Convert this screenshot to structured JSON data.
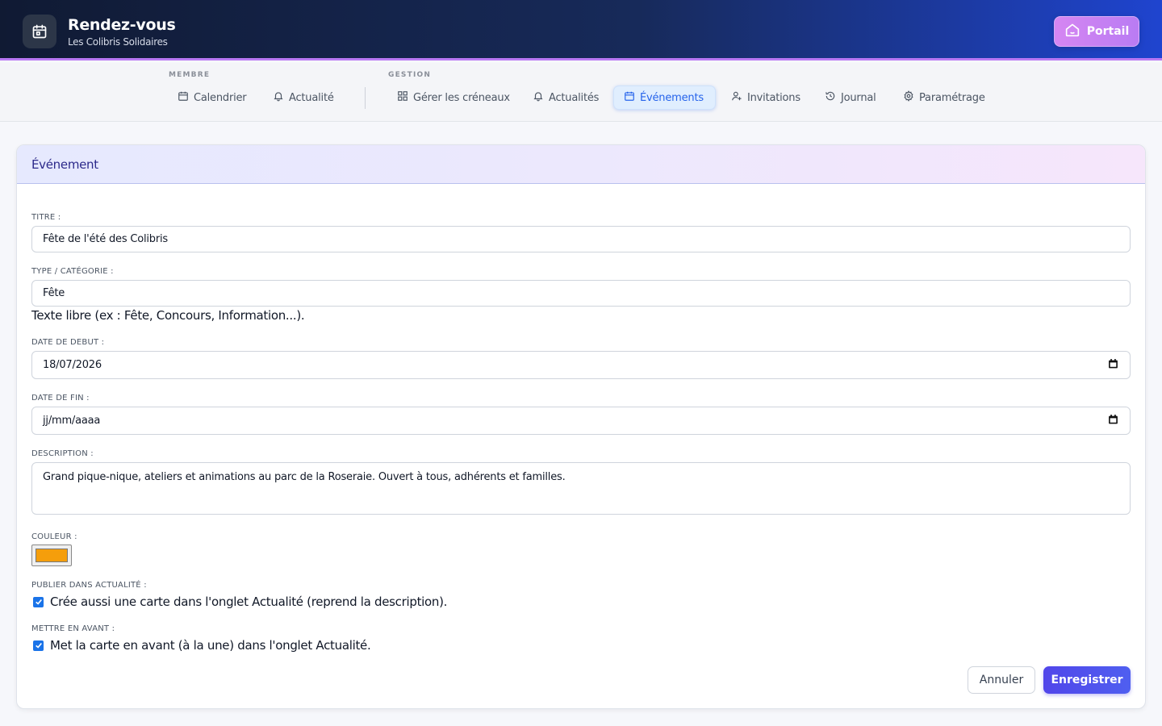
{
  "header": {
    "title": "Rendez-vous",
    "subtitle": "Les Colibris Solidaires",
    "portal_label": "Portail"
  },
  "nav": {
    "groups": [
      {
        "label": "MEMBRE"
      },
      {
        "label": "GESTION"
      }
    ],
    "items": [
      {
        "label": "Calendrier",
        "icon": "calendar-icon"
      },
      {
        "label": "Actualité",
        "icon": "bell-icon"
      },
      {
        "label": "Gérer les créneaux",
        "icon": "grid-icon"
      },
      {
        "label": "Actualités",
        "icon": "bell-icon"
      },
      {
        "label": "Événements",
        "icon": "calendar-icon",
        "active": true
      },
      {
        "label": "Invitations",
        "icon": "user-plus-icon"
      },
      {
        "label": "Journal",
        "icon": "history-icon"
      },
      {
        "label": "Paramétrage",
        "icon": "gear-icon"
      }
    ]
  },
  "form": {
    "heading": "Événement",
    "title": {
      "label": "TITRE :",
      "value": "Fête de l'été des Colibris"
    },
    "type": {
      "label": "TYPE / CATÉGORIE :",
      "value": "Fête",
      "help": "Texte libre (ex : Fête, Concours, Information...)."
    },
    "start_date": {
      "label": "DATE DE DEBUT :",
      "value": "18/07/2026"
    },
    "end_date": {
      "label": "DATE DE FIN :",
      "placeholder": "jj/mm/aaaa"
    },
    "description": {
      "label": "DESCRIPTION :",
      "value": "Grand pique-nique, ateliers et animations au parc de la Roseraie. Ouvert à tous, adhérents et familles."
    },
    "color": {
      "label": "COULEUR :",
      "value": "#f59e0b"
    },
    "publish": {
      "label": "PUBLIER DANS ACTUALITÉ :",
      "text": "Crée aussi une carte dans l'onglet Actualité (reprend la description).",
      "checked": true
    },
    "feature": {
      "label": "METTRE EN AVANT :",
      "text": "Met la carte en avant (à la une) dans l'onglet Actualité.",
      "checked": true
    },
    "cancel_label": "Annuler",
    "save_label": "Enregistrer"
  },
  "colors": {
    "accent": "#4f46e5",
    "active_tab": "#2563eb",
    "checkbox": "#1a73e8"
  }
}
